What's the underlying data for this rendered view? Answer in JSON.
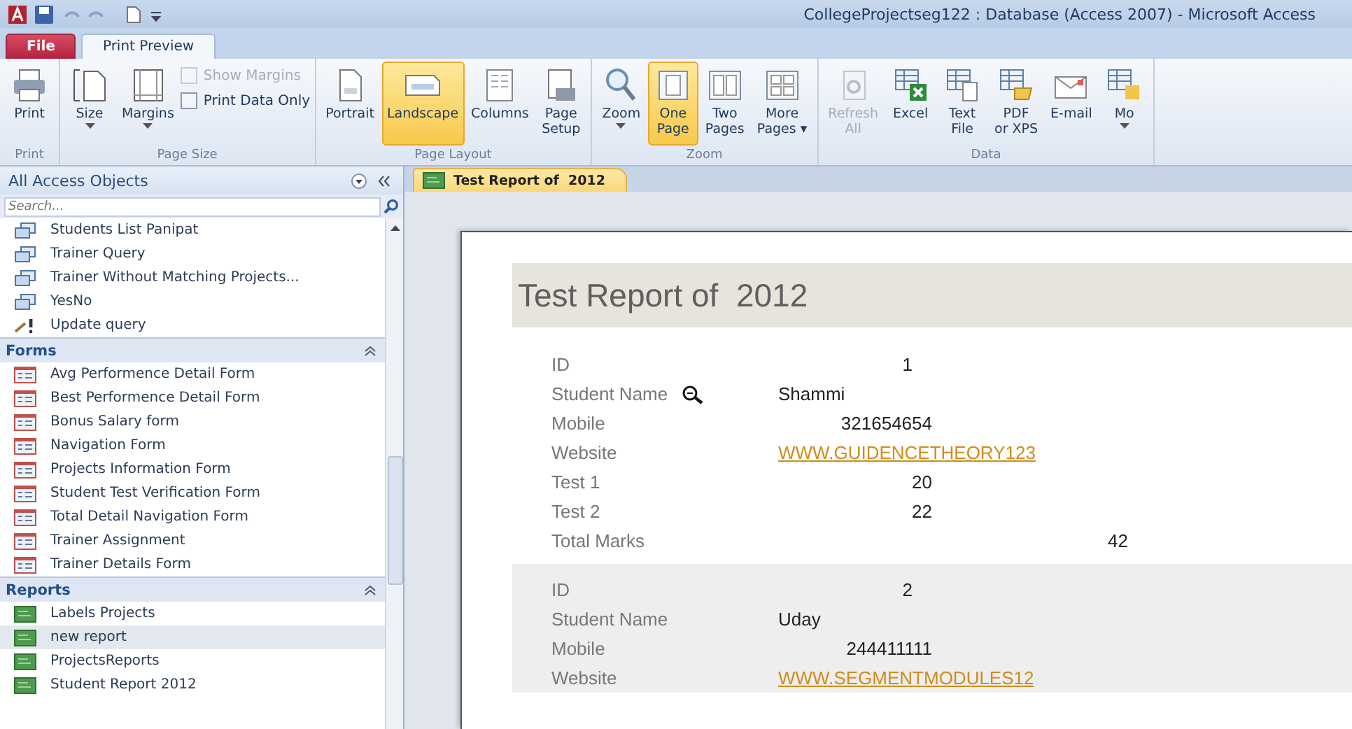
{
  "window": {
    "title": "CollegeProjectseg122 : Database (Access 2007)  -  Microsoft Access"
  },
  "ribbon_tabs": [
    {
      "label": "File",
      "kind": "file",
      "selected": false
    },
    {
      "label": "Print Preview",
      "kind": "tab",
      "selected": true
    }
  ],
  "ribbon_groups": [
    {
      "label": "Print",
      "items": [
        {
          "kind": "button",
          "label": "Print",
          "selected": false,
          "disabled": false,
          "dropdown": false
        }
      ]
    },
    {
      "label": "Page Size",
      "items": [
        {
          "kind": "button",
          "label": "Size",
          "selected": false,
          "disabled": false,
          "dropdown": true
        },
        {
          "kind": "button",
          "label": "Margins",
          "selected": false,
          "disabled": false,
          "dropdown": true
        },
        {
          "kind": "checkbox",
          "label": "Show Margins",
          "checked": false,
          "disabled": true
        },
        {
          "kind": "checkbox",
          "label": "Print Data Only",
          "checked": false,
          "disabled": false
        }
      ]
    },
    {
      "label": "Page Layout",
      "items": [
        {
          "kind": "button",
          "label": "Portrait",
          "selected": false,
          "disabled": false,
          "dropdown": false
        },
        {
          "kind": "button",
          "label": "Landscape",
          "selected": true,
          "disabled": false,
          "dropdown": false
        },
        {
          "kind": "button",
          "label": "Columns",
          "selected": false,
          "disabled": false,
          "dropdown": false
        },
        {
          "kind": "button",
          "label": "Page\nSetup",
          "selected": false,
          "disabled": false,
          "dropdown": false
        }
      ]
    },
    {
      "label": "Zoom",
      "items": [
        {
          "kind": "button",
          "label": "Zoom",
          "selected": false,
          "disabled": false,
          "dropdown": true
        },
        {
          "kind": "button",
          "label": "One\nPage",
          "selected": true,
          "disabled": false,
          "dropdown": false
        },
        {
          "kind": "button",
          "label": "Two\nPages",
          "selected": false,
          "disabled": false,
          "dropdown": false
        },
        {
          "kind": "button",
          "label": "More\nPages ▾",
          "selected": false,
          "disabled": false,
          "dropdown": false
        }
      ]
    },
    {
      "label": "Data",
      "items": [
        {
          "kind": "button",
          "label": "Refresh\nAll",
          "selected": false,
          "disabled": true,
          "dropdown": false
        },
        {
          "kind": "button",
          "label": "Excel",
          "selected": false,
          "disabled": false,
          "dropdown": false
        },
        {
          "kind": "button",
          "label": "Text\nFile",
          "selected": false,
          "disabled": false,
          "dropdown": false
        },
        {
          "kind": "button",
          "label": "PDF\nor XPS",
          "selected": false,
          "disabled": false,
          "dropdown": false
        },
        {
          "kind": "button",
          "label": "E-mail",
          "selected": false,
          "disabled": false,
          "dropdown": false
        },
        {
          "kind": "button",
          "label": "Mo",
          "selected": false,
          "disabled": false,
          "dropdown": true
        }
      ]
    }
  ],
  "nav_pane": {
    "title": "All Access Objects",
    "search": {
      "placeholder": "Search..."
    },
    "sections": [
      {
        "items": [
          {
            "label": "Students List Panipat",
            "kind": "query",
            "selected": false
          },
          {
            "label": "Trainer Query",
            "kind": "query",
            "selected": false
          },
          {
            "label": "Trainer Without Matching Projects...",
            "kind": "query",
            "selected": false
          },
          {
            "label": "YesNo",
            "kind": "query",
            "selected": false
          },
          {
            "label": "Update query",
            "kind": "update",
            "selected": false
          }
        ]
      },
      {
        "title": "Forms",
        "items": [
          {
            "label": "Avg Performence Detail Form",
            "kind": "form",
            "selected": false
          },
          {
            "label": "Best Performence Detail Form",
            "kind": "form",
            "selected": false
          },
          {
            "label": "Bonus Salary form",
            "kind": "form",
            "selected": false
          },
          {
            "label": "Navigation Form",
            "kind": "form",
            "selected": false
          },
          {
            "label": "Projects Information Form",
            "kind": "form",
            "selected": false
          },
          {
            "label": "Student Test Verification Form",
            "kind": "form",
            "selected": false
          },
          {
            "label": "Total Detail Navigation Form",
            "kind": "form",
            "selected": false
          },
          {
            "label": "Trainer Assignment",
            "kind": "form",
            "selected": false
          },
          {
            "label": "Trainer Details Form",
            "kind": "form",
            "selected": false
          }
        ]
      },
      {
        "title": "Reports",
        "items": [
          {
            "label": "Labels Projects",
            "kind": "report",
            "selected": false
          },
          {
            "label": "new report",
            "kind": "report",
            "selected": true
          },
          {
            "label": "ProjectsReports",
            "kind": "report",
            "selected": false
          },
          {
            "label": "Student Report 2012",
            "kind": "report",
            "selected": false
          }
        ]
      }
    ]
  },
  "document_tabs": [
    {
      "label": "Test Report of  2012",
      "selected": true
    }
  ],
  "report": {
    "title": "Test Report of  2012",
    "records": [
      {
        "shaded": false,
        "fields": [
          {
            "label": "ID",
            "value": "1",
            "kind": "id"
          },
          {
            "label": "Student Name",
            "value": "Shammi",
            "kind": "text"
          },
          {
            "label": "Mobile",
            "value": "321654654",
            "kind": "number"
          },
          {
            "label": "Website",
            "value": "WWW.GUIDENCETHEORY123",
            "kind": "link"
          },
          {
            "label": "Test 1",
            "value": "20",
            "kind": "number"
          },
          {
            "label": "Test 2",
            "value": "22",
            "kind": "number"
          },
          {
            "label": "Total Marks",
            "value": "42",
            "kind": "total"
          }
        ]
      },
      {
        "shaded": true,
        "fields": [
          {
            "label": "ID",
            "value": "2",
            "kind": "id"
          },
          {
            "label": "Student Name",
            "value": "Uday",
            "kind": "text"
          },
          {
            "label": "Mobile",
            "value": "244411111",
            "kind": "number"
          },
          {
            "label": "Website",
            "value": "WWW.SEGMENTMODULES12",
            "kind": "link"
          }
        ]
      }
    ]
  }
}
